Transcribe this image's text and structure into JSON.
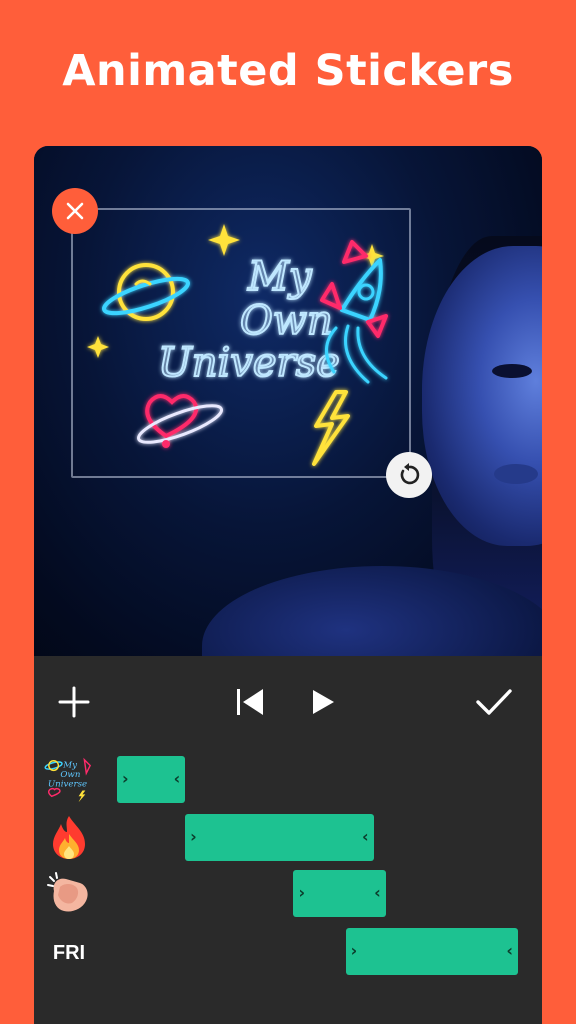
{
  "headline": "Animated Stickers",
  "sticker": {
    "lines": [
      "My",
      "Own",
      "Universe"
    ]
  },
  "toolbar": {
    "icons": [
      "plus-icon",
      "skip-back-icon",
      "play-icon",
      "check-icon"
    ]
  },
  "tracks": [
    {
      "icon": "my-own-universe-sticker-icon",
      "label": "",
      "clip_start": 0.0,
      "clip_end": 0.17
    },
    {
      "icon": "fire-emoji-icon",
      "label": "",
      "clip_start": 0.17,
      "clip_end": 0.64
    },
    {
      "icon": "clapping-hand-emoji-icon",
      "label": "",
      "clip_start": 0.44,
      "clip_end": 0.67
    },
    {
      "icon": "",
      "label": "FRI",
      "clip_start": 0.57,
      "clip_end": 1.0
    }
  ],
  "colors": {
    "background": "#FF5E3A",
    "clip": "#1DC291",
    "panel": "#2a2a2a",
    "close_button": "#FF5E3A"
  }
}
